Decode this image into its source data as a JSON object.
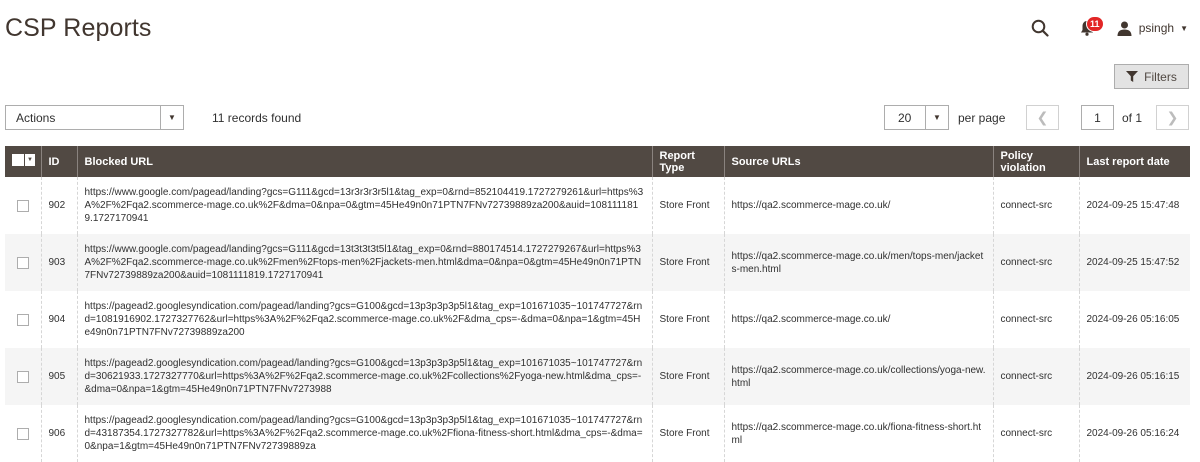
{
  "page": {
    "title": "CSP Reports"
  },
  "header": {
    "notifications_count": "11",
    "username": "psingh",
    "icons": {
      "search": "search-icon",
      "notifications": "bell-icon",
      "user": "user-icon"
    }
  },
  "toolbar": {
    "filters_label": "Filters",
    "actions_label": "Actions",
    "records_found": "11 records found",
    "per_page_value": "20",
    "per_page_label": "per page",
    "current_page": "1",
    "of_pages": "of 1"
  },
  "grid": {
    "columns": [
      "ID",
      "Blocked URL",
      "Report Type",
      "Source URLs",
      "Policy violation",
      "Last report date"
    ],
    "rows": [
      {
        "id": "902",
        "blocked_url": "https://www.google.com/pagead/landing?gcs=G111&gcd=13r3r3r3r5l1&tag_exp=0&rnd=852104419.1727279261&url=https%3A%2F%2Fqa2.scommerce-mage.co.uk%2F&dma=0&npa=0&gtm=45He49n0n71PTN7FNv72739889za200&auid=1081111819.1727170941",
        "report_type": "Store Front",
        "source_urls": "https://qa2.scommerce-mage.co.uk/",
        "policy_violation": "connect-src",
        "last_report_date": "2024-09-25 15:47:48"
      },
      {
        "id": "903",
        "blocked_url": "https://www.google.com/pagead/landing?gcs=G111&gcd=13t3t3t3t5l1&tag_exp=0&rnd=880174514.1727279267&url=https%3A%2F%2Fqa2.scommerce-mage.co.uk%2Fmen%2Ftops-men%2Fjackets-men.html&dma=0&npa=0&gtm=45He49n0n71PTN7FNv72739889za200&auid=1081111819.1727170941",
        "report_type": "Store Front",
        "source_urls": "https://qa2.scommerce-mage.co.uk/men/tops-men/jackets-men.html",
        "policy_violation": "connect-src",
        "last_report_date": "2024-09-25 15:47:52"
      },
      {
        "id": "904",
        "blocked_url": "https://pagead2.googlesyndication.com/pagead/landing?gcs=G100&gcd=13p3p3p3p5l1&tag_exp=101671035~101747727&rnd=1081916902.1727327762&url=https%3A%2F%2Fqa2.scommerce-mage.co.uk%2F&dma_cps=-&dma=0&npa=1&gtm=45He49n0n71PTN7FNv72739889za200",
        "report_type": "Store Front",
        "source_urls": "https://qa2.scommerce-mage.co.uk/",
        "policy_violation": "connect-src",
        "last_report_date": "2024-09-26 05:16:05"
      },
      {
        "id": "905",
        "blocked_url": "https://pagead2.googlesyndication.com/pagead/landing?gcs=G100&gcd=13p3p3p3p5l1&tag_exp=101671035~101747727&rnd=30621933.1727327770&url=https%3A%2F%2Fqa2.scommerce-mage.co.uk%2Fcollections%2Fyoga-new.html&dma_cps=-&dma=0&npa=1&gtm=45He49n0n71PTN7FNv7273988",
        "report_type": "Store Front",
        "source_urls": "https://qa2.scommerce-mage.co.uk/collections/yoga-new.html",
        "policy_violation": "connect-src",
        "last_report_date": "2024-09-26 05:16:15"
      },
      {
        "id": "906",
        "blocked_url": "https://pagead2.googlesyndication.com/pagead/landing?gcs=G100&gcd=13p3p3p3p5l1&tag_exp=101671035~101747727&rnd=43187354.1727327782&url=https%3A%2F%2Fqa2.scommerce-mage.co.uk%2Ffiona-fitness-short.html&dma_cps=-&dma=0&npa=1&gtm=45He49n0n71PTN7FNv72739889za",
        "report_type": "Store Front",
        "source_urls": "https://qa2.scommerce-mage.co.uk/fiona-fitness-short.html",
        "policy_violation": "connect-src",
        "last_report_date": "2024-09-26 05:16:24"
      }
    ]
  },
  "colors": {
    "header_bg": "#514943",
    "badge": "#e22626",
    "title": "#41362f"
  }
}
